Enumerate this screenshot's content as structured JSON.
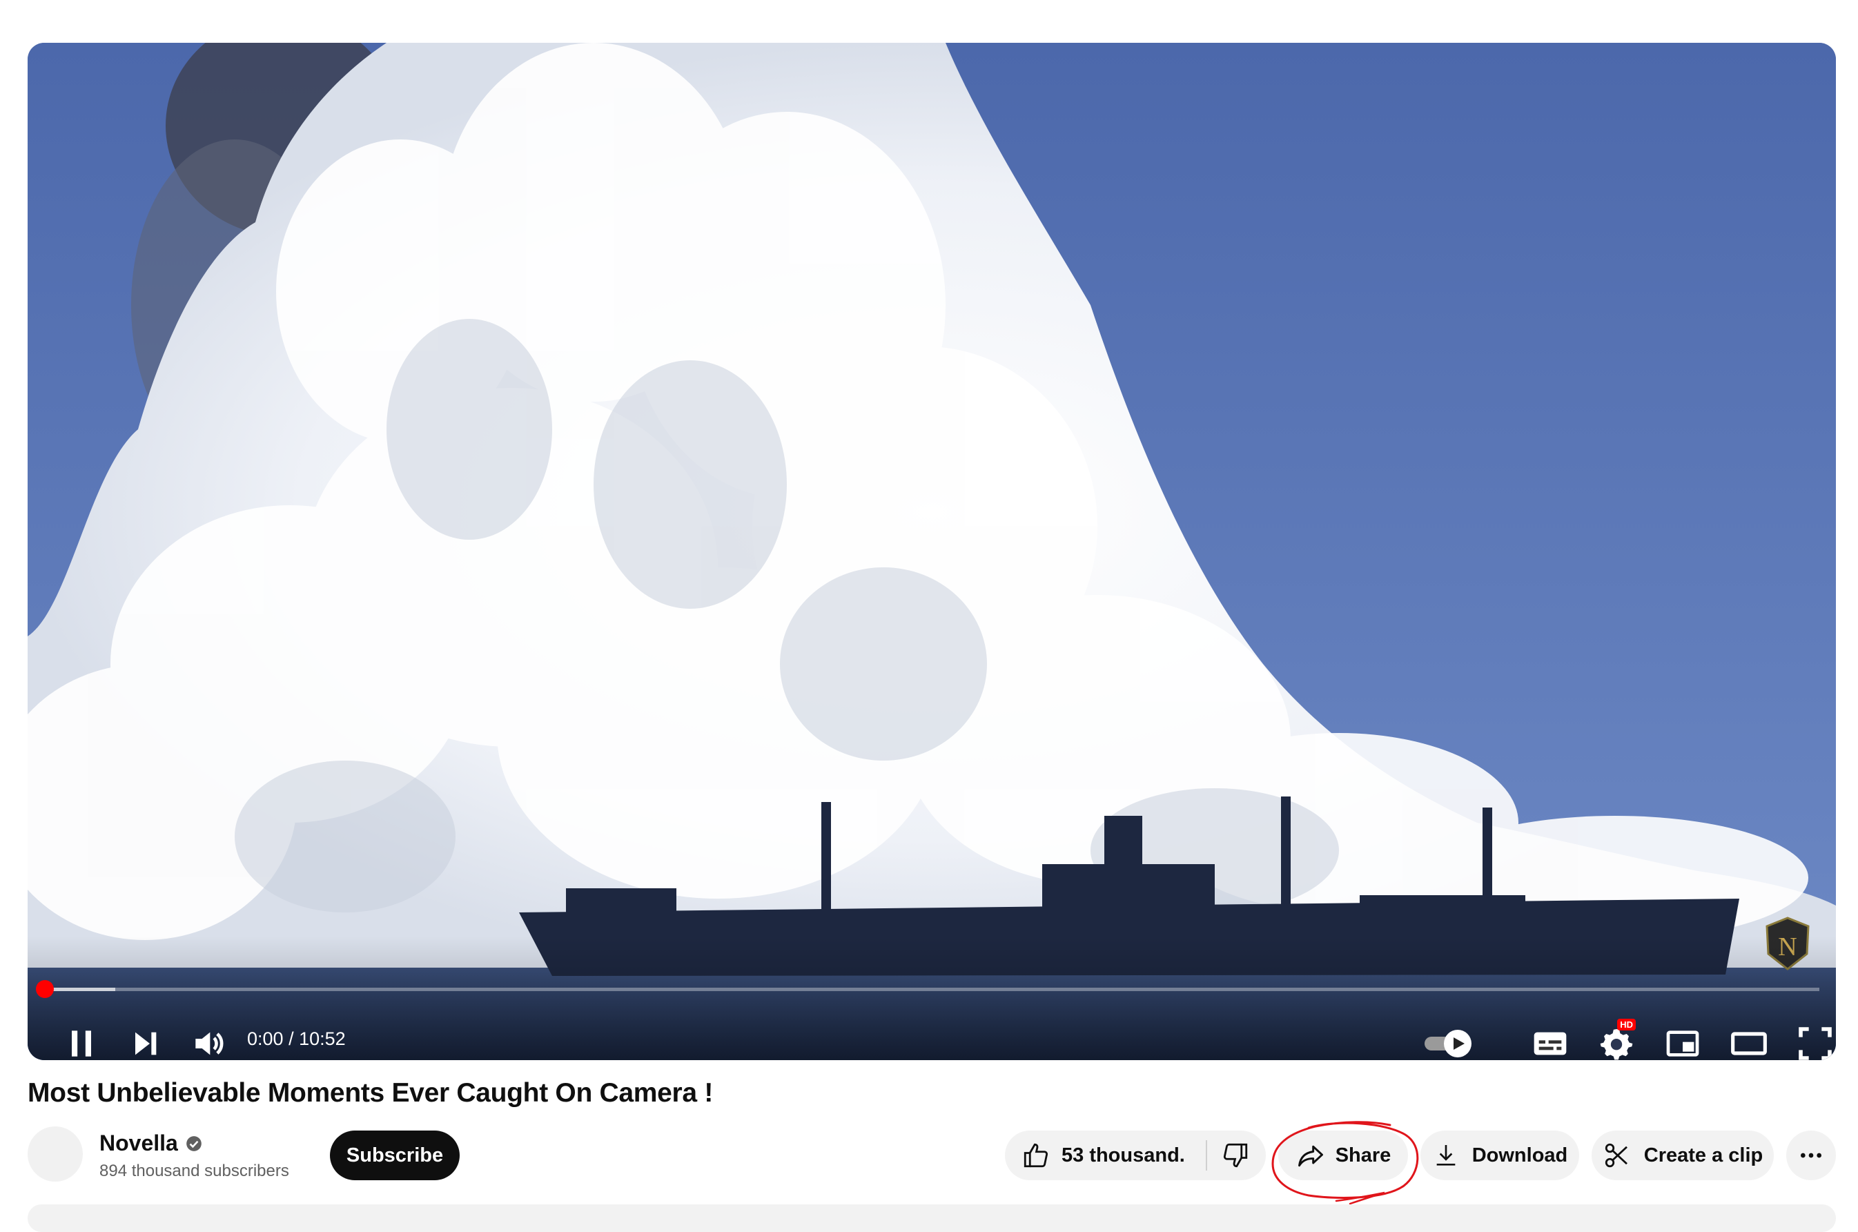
{
  "player": {
    "time_current": "0:00",
    "time_total": "10:52",
    "time_separator": " / ",
    "progress_fraction": 0.0,
    "buffered_fraction": 0.04,
    "hd_badge": "HD",
    "watermark_letter": "N",
    "accent_color": "#ff0000",
    "icons": [
      "pause-icon",
      "next-icon",
      "volume-icon",
      "autoplay-toggle-icon",
      "subtitles-icon",
      "settings-icon",
      "miniplayer-icon",
      "theater-mode-icon",
      "fullscreen-icon"
    ]
  },
  "video": {
    "title": "Most Unbelievable Moments Ever Caught On Camera !"
  },
  "channel": {
    "name": "Novella",
    "subscribers": "894 thousand subscribers",
    "verified_icon": "verified-check-icon"
  },
  "actions": {
    "subscribe_label": "Subscribe",
    "like_count": "53 thousand.",
    "share_label": "Share",
    "download_label": "Download",
    "clip_label": "Create a clip",
    "more_icon": "more-horizontal-icon"
  },
  "annotation": {
    "color": "#e0151b",
    "target": "share-button"
  }
}
